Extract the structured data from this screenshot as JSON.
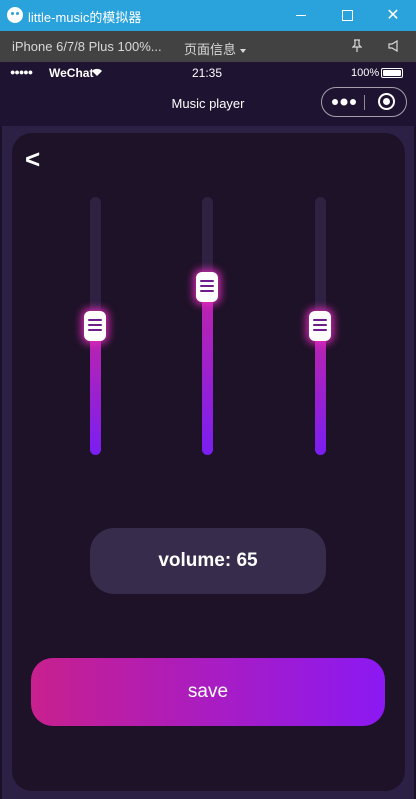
{
  "window": {
    "title": "little-music的模拟器",
    "minimize_label": "",
    "close_label": "✕"
  },
  "simulator": {
    "device": "iPhone 6/7/8 Plus 100%...",
    "page_info": "页面信息"
  },
  "status_bar": {
    "signal": "●●●●●",
    "carrier": "WeChat",
    "time": "21:35",
    "battery_percent": "100%"
  },
  "navbar": {
    "title": "Music player"
  },
  "page": {
    "back_symbol": "<",
    "sliders": [
      {
        "name": "slider-1",
        "level": 0.5
      },
      {
        "name": "slider-2",
        "level": 0.65
      },
      {
        "name": "slider-3",
        "level": 0.5
      }
    ],
    "volume_text": "volume: 65",
    "save_label": "save"
  },
  "colors": {
    "background": "#1d1227",
    "accent_start": "#c8208e",
    "accent_end": "#8b19f3",
    "titlebar": "#2aa3dd"
  }
}
